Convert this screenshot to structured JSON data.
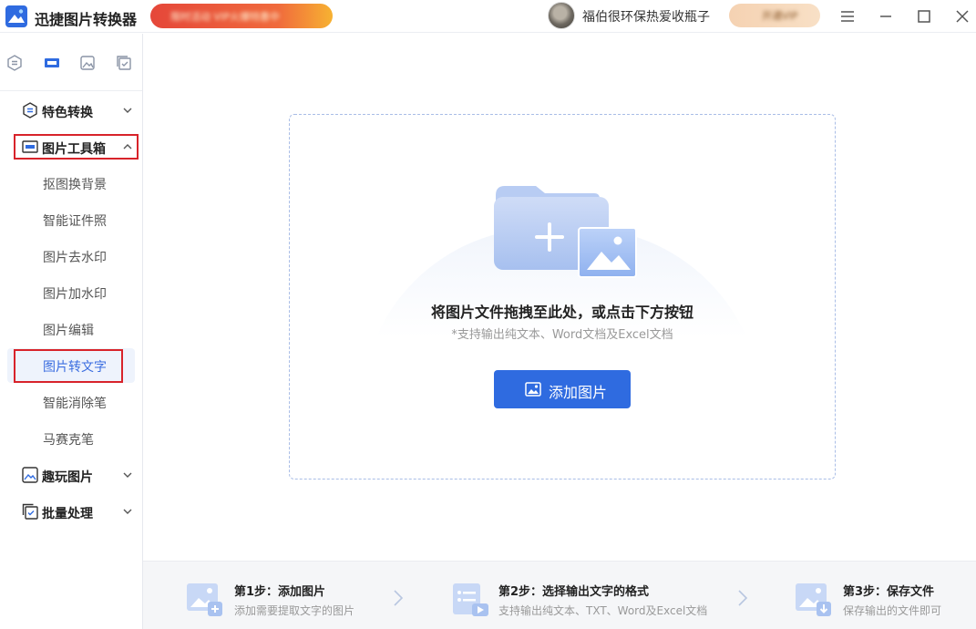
{
  "app": {
    "title": "迅捷图片转换器",
    "promo_text": "限时活动 VIP火爆特惠中",
    "username": "福伯很环保热爱收瓶子",
    "vip_label": "开通VIP"
  },
  "sidebar": {
    "sections": [
      {
        "label": "特色转换",
        "icon": "convert-icon",
        "expanded": false
      },
      {
        "label": "图片工具箱",
        "icon": "toolbox-icon",
        "expanded": true
      },
      {
        "label": "趣玩图片",
        "icon": "image-play-icon",
        "expanded": false
      },
      {
        "label": "批量处理",
        "icon": "batch-icon",
        "expanded": false
      }
    ],
    "tools": [
      "抠图换背景",
      "智能证件照",
      "图片去水印",
      "图片加水印",
      "图片编辑",
      "图片转文字",
      "智能消除笔",
      "马赛克笔"
    ],
    "active_tool": "图片转文字"
  },
  "main": {
    "drop_title": "将图片文件拖拽至此处，或点击下方按钮",
    "drop_subtitle": "*支持输出纯文本、Word文档及Excel文档",
    "add_button": "添加图片"
  },
  "steps": [
    {
      "title": "第1步：添加图片",
      "desc": "添加需要提取文字的图片"
    },
    {
      "title": "第2步：选择输出文字的格式",
      "desc": "支持输出纯文本、TXT、Word及Excel文档"
    },
    {
      "title": "第3步：保存文件",
      "desc": "保存输出的文件即可"
    }
  ],
  "colors": {
    "accent": "#2f6be0",
    "highlight": "#d8232a",
    "active_bg": "#eef3fc"
  }
}
